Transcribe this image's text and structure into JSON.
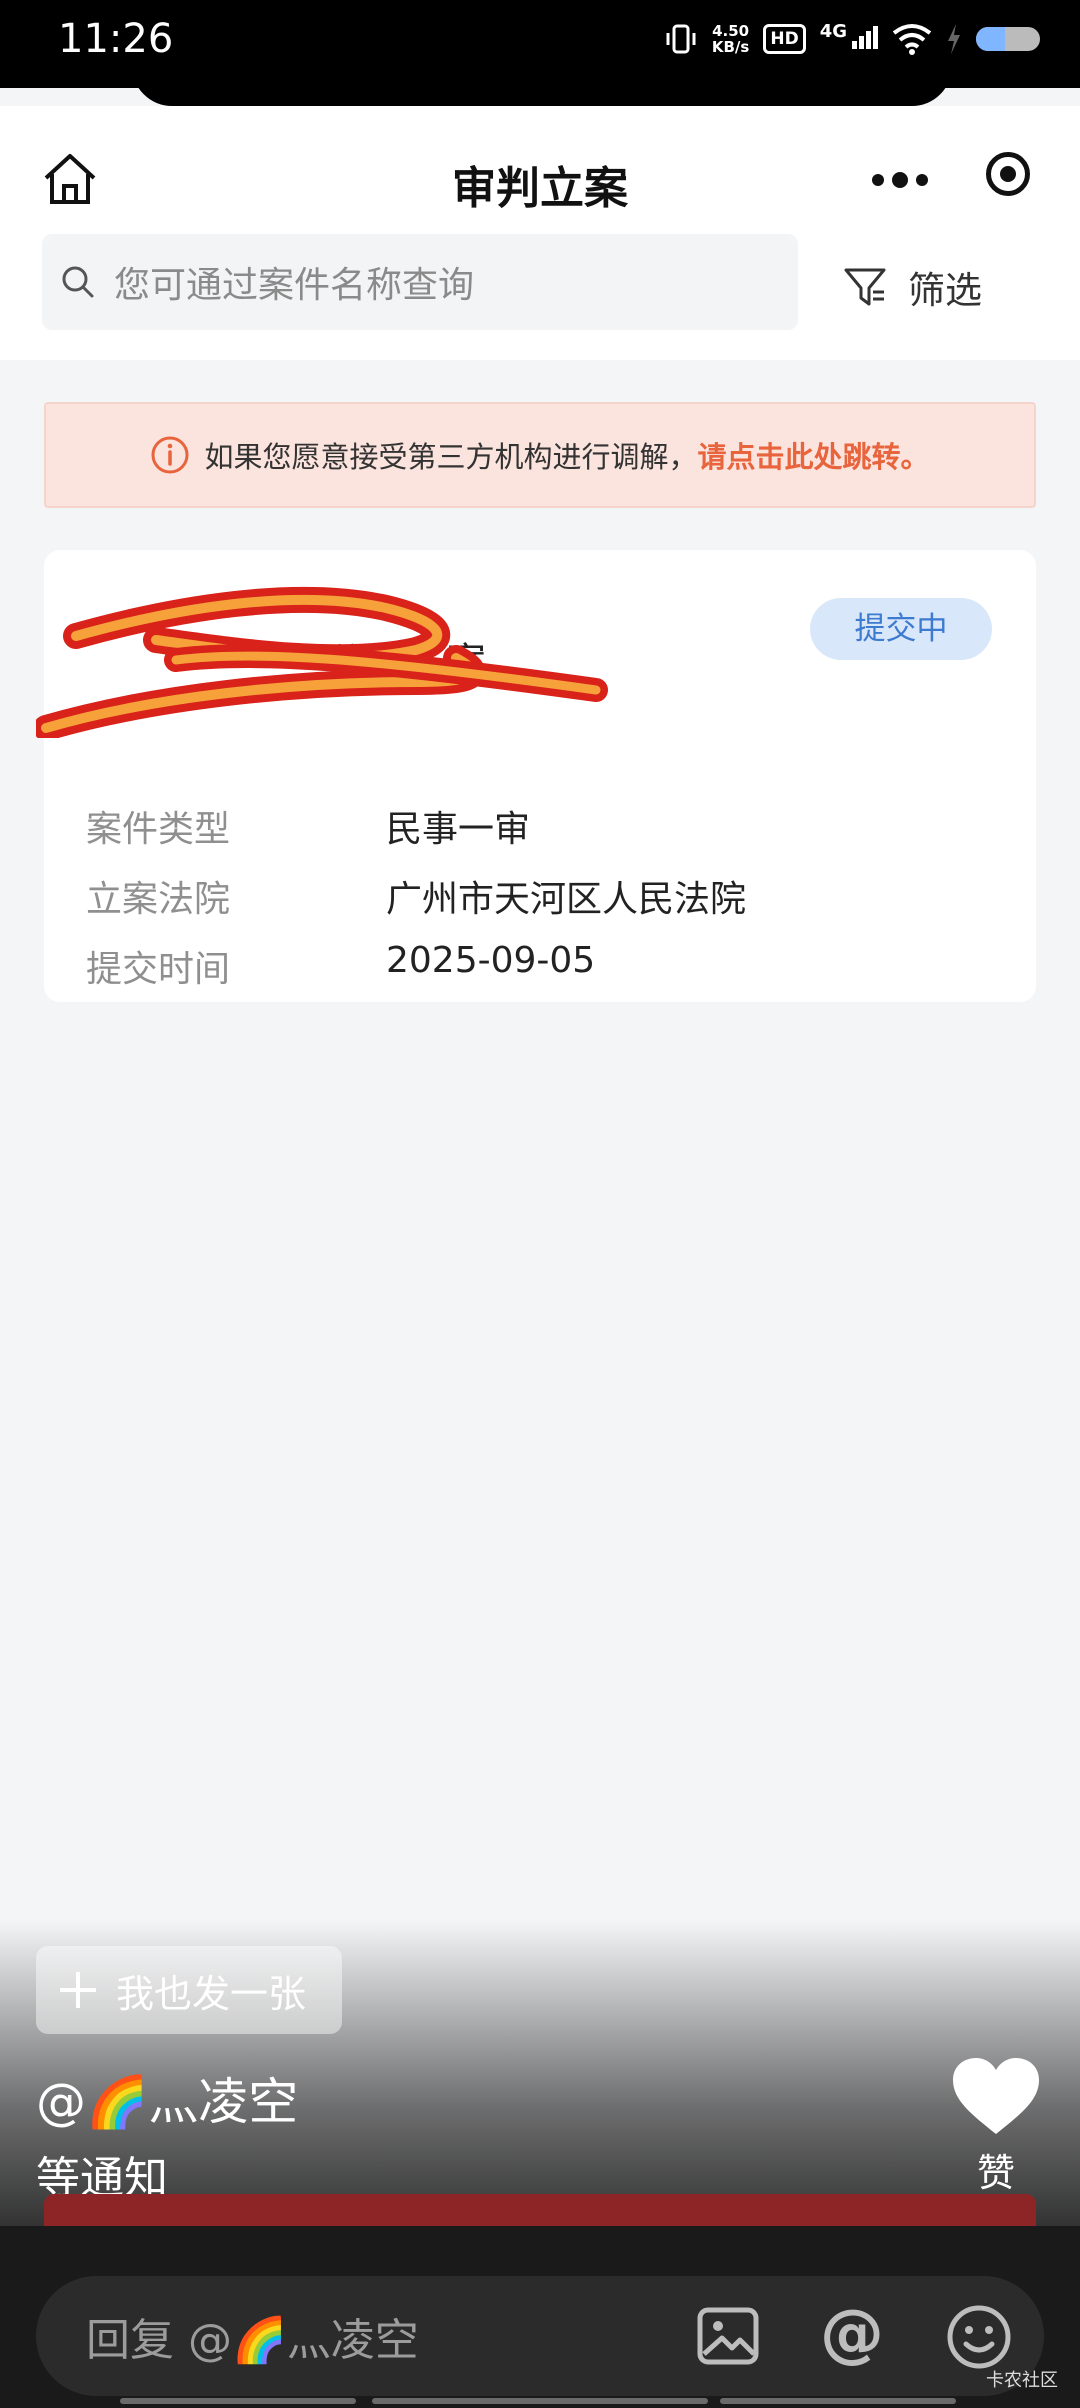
{
  "status_bar": {
    "time": "11:26",
    "net_speed_value": "4.50",
    "net_speed_unit": "KB/s",
    "hd": "HD",
    "network": "4G",
    "battery_level": 0.45
  },
  "header": {
    "title": "审判立案"
  },
  "search": {
    "placeholder": "您可通过案件名称查询",
    "filter_label": "筛选"
  },
  "notice": {
    "text": "如果您愿意接受第三方机构进行调解，",
    "link": "请点击此处跳转。"
  },
  "case_card": {
    "title": "公司一案",
    "status": "提交中",
    "fields": [
      {
        "label": "案件类型",
        "value": "民事一审"
      },
      {
        "label": "立案法院",
        "value": "广州市天河区人民法院"
      },
      {
        "label": "提交时间",
        "value": "2025-09-05"
      }
    ]
  },
  "post": {
    "post_button": "我也发一张",
    "author": "@🌈灬凌空",
    "caption": "等通知",
    "like_label": "赞"
  },
  "reply": {
    "placeholder": "回复 @🌈灬凌空",
    "at_symbol": "@"
  },
  "watermark": "卡农社区",
  "colors": {
    "accent_link": "#e8643c",
    "badge_bg": "#d8e7fa",
    "badge_text": "#3d7bd0",
    "notice_bg": "#fbe3de"
  }
}
